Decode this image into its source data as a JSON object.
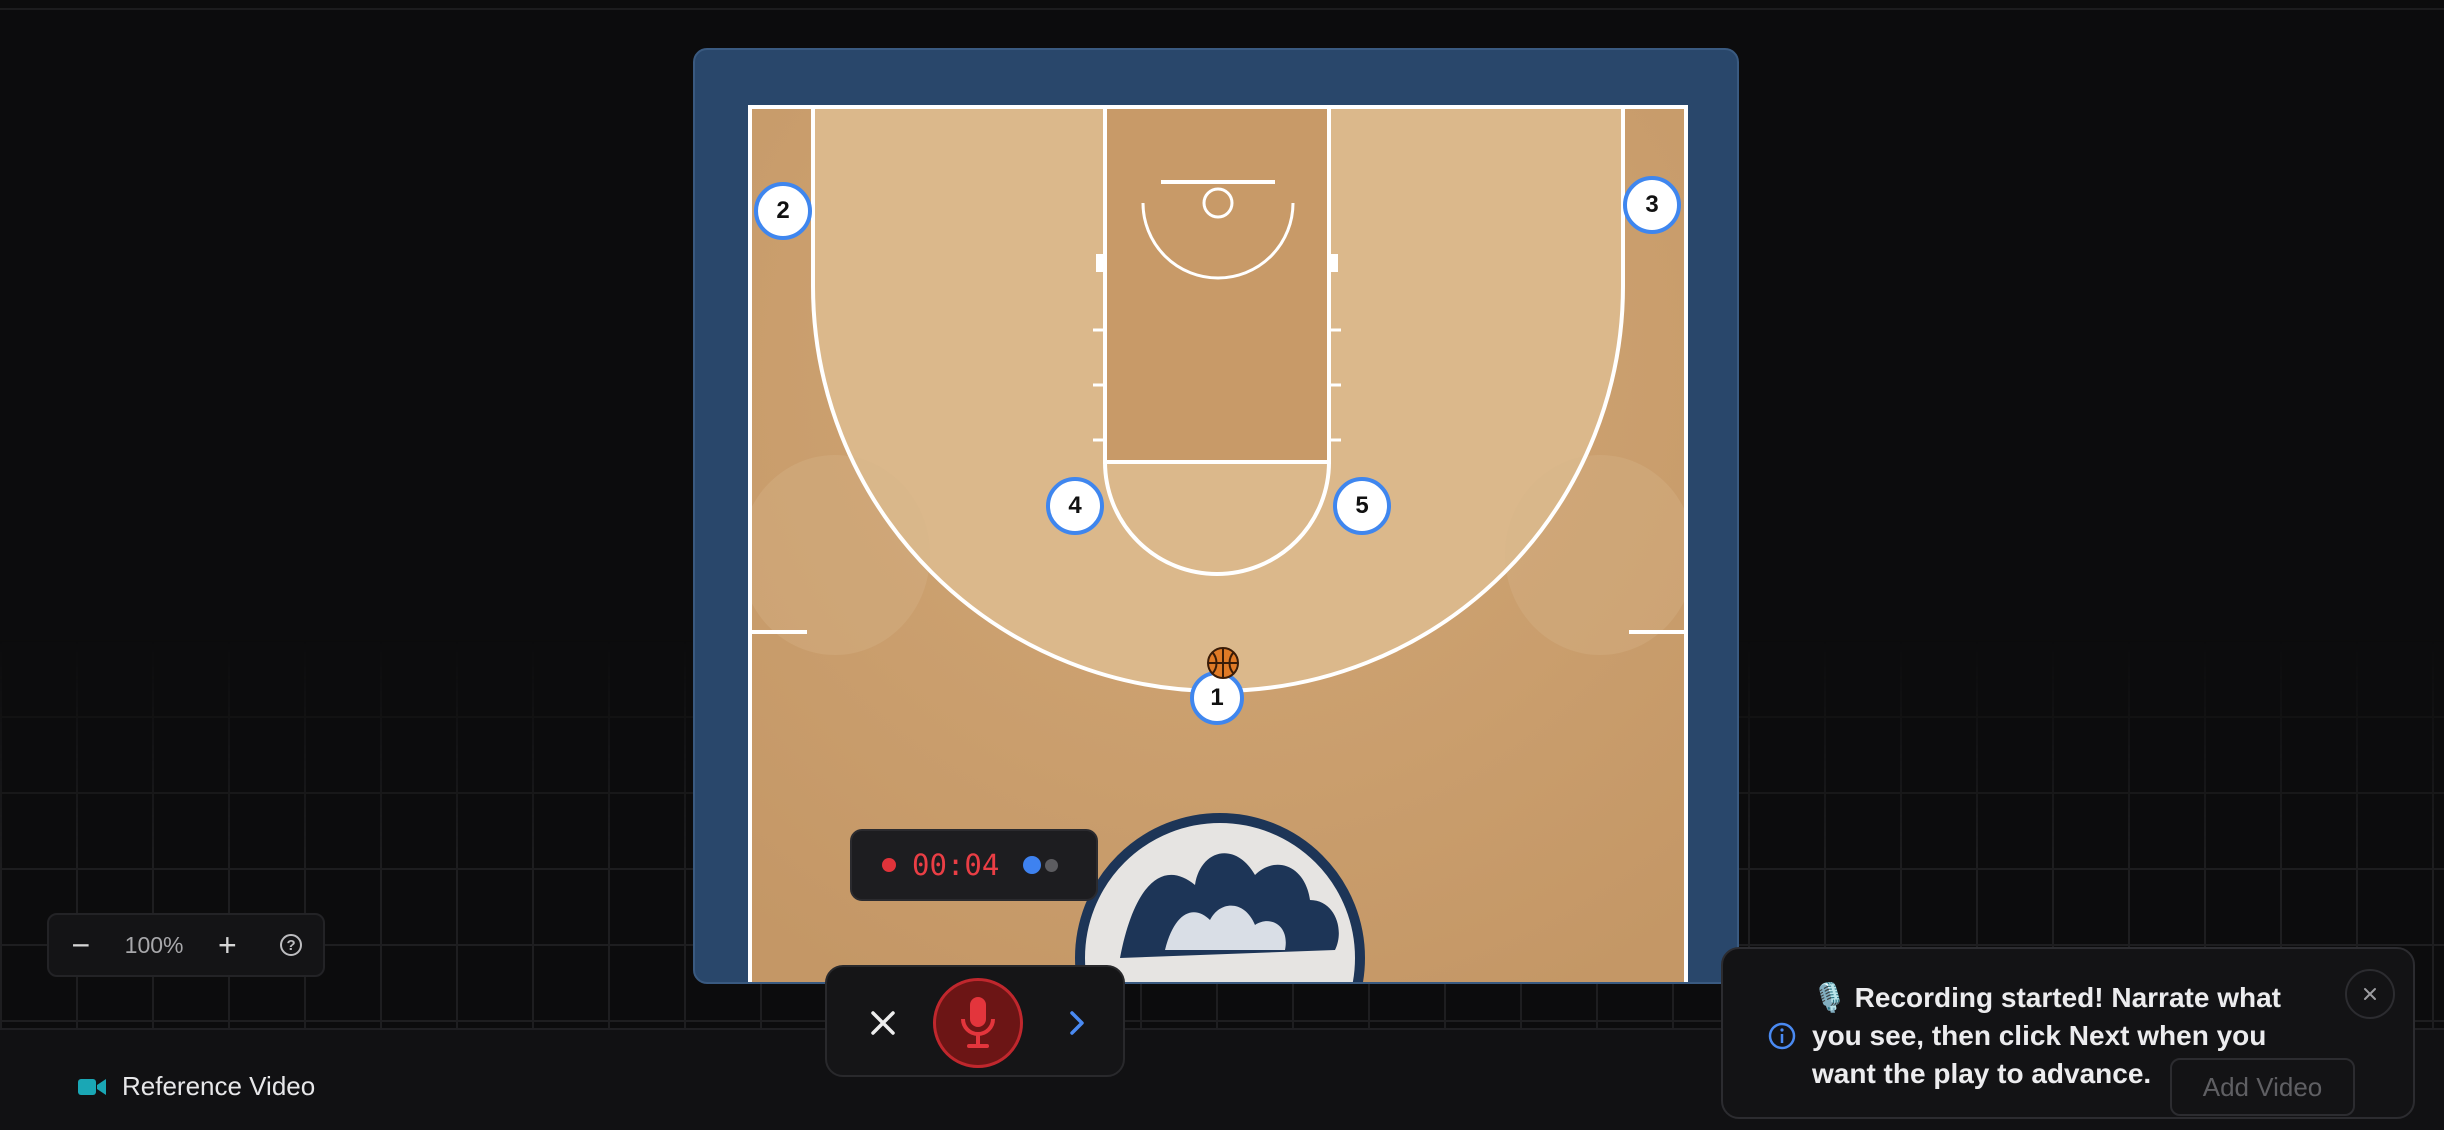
{
  "zoom": {
    "minus_label": "−",
    "level": "100%",
    "plus_label": "+",
    "help_label": "?"
  },
  "court": {
    "players": [
      {
        "number": "1"
      },
      {
        "number": "2"
      },
      {
        "number": "3"
      },
      {
        "number": "4"
      },
      {
        "number": "5"
      }
    ],
    "ball_holder": "1"
  },
  "recording": {
    "timer": "00:04",
    "state": "recording"
  },
  "controls": {
    "cancel_icon": "close-icon",
    "mic_icon": "microphone-icon",
    "next_icon": "chevron-right-icon"
  },
  "bottom_bar": {
    "reference_video_label": "Reference Video"
  },
  "toast": {
    "emoji": "🎙️",
    "message": "Recording started! Narrate what you see, then click Next when you want the play to advance.",
    "add_video_label": "Add Video"
  },
  "colors": {
    "court_wood": "#c99e6c",
    "court_paint": "#d9b283",
    "court_border": "#29476b",
    "record_red": "#e0333a",
    "accent_blue": "#3e82f0"
  }
}
